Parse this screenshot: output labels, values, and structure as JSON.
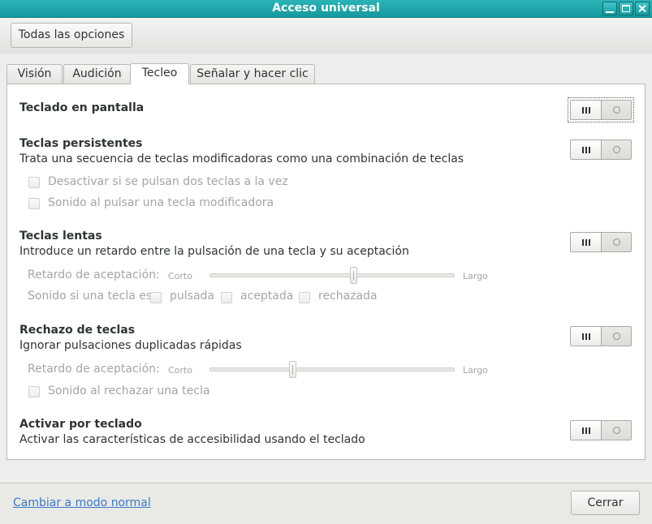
{
  "window": {
    "title": "Acceso universal"
  },
  "toolbar": {
    "all_settings_label": "Todas las opciones"
  },
  "tabs": [
    {
      "label": "Visión",
      "active": false
    },
    {
      "label": "Audición",
      "active": false
    },
    {
      "label": "Tecleo",
      "active": true
    },
    {
      "label": "Señalar y hacer clic",
      "active": false
    }
  ],
  "sections": {
    "on_screen_keyboard": {
      "title": "Teclado en pantalla",
      "switch_on": false
    },
    "sticky_keys": {
      "title": "Teclas persistentes",
      "description": "Trata una secuencia de teclas modificadoras como una combinación de teclas",
      "switch_on": false,
      "options": [
        {
          "label": "Desactivar si se pulsan dos teclas a la vez",
          "checked": false,
          "enabled": false
        },
        {
          "label": "Sonido al pulsar una tecla modificadora",
          "checked": false,
          "enabled": false
        }
      ]
    },
    "slow_keys": {
      "title": "Teclas lentas",
      "description": "Introduce un retardo entre la pulsación de una tecla y su aceptación",
      "switch_on": false,
      "delay_label": "Retardo de aceptación:",
      "short_label": "Corto",
      "long_label": "Largo",
      "delay_value": 0.59,
      "beep_label": "Sonido si una tecla es",
      "beep_options": [
        {
          "label": "pulsada",
          "checked": false
        },
        {
          "label": "aceptada",
          "checked": false
        },
        {
          "label": "rechazada",
          "checked": false
        }
      ]
    },
    "bounce_keys": {
      "title": "Rechazo de teclas",
      "description": "Ignorar pulsaciones duplicadas rápidas",
      "switch_on": false,
      "delay_label": "Retardo de aceptación:",
      "short_label": "Corto",
      "long_label": "Largo",
      "delay_value": 0.34,
      "reject_beep_label": "Sonido al rechazar una tecla"
    },
    "enable_by_keyboard": {
      "title": "Activar por teclado",
      "description": "Activar las características de accesibilidad usando el teclado",
      "switch_on": false
    }
  },
  "footer": {
    "mode_link": "Cambiar a modo normal",
    "close_label": "Cerrar"
  }
}
